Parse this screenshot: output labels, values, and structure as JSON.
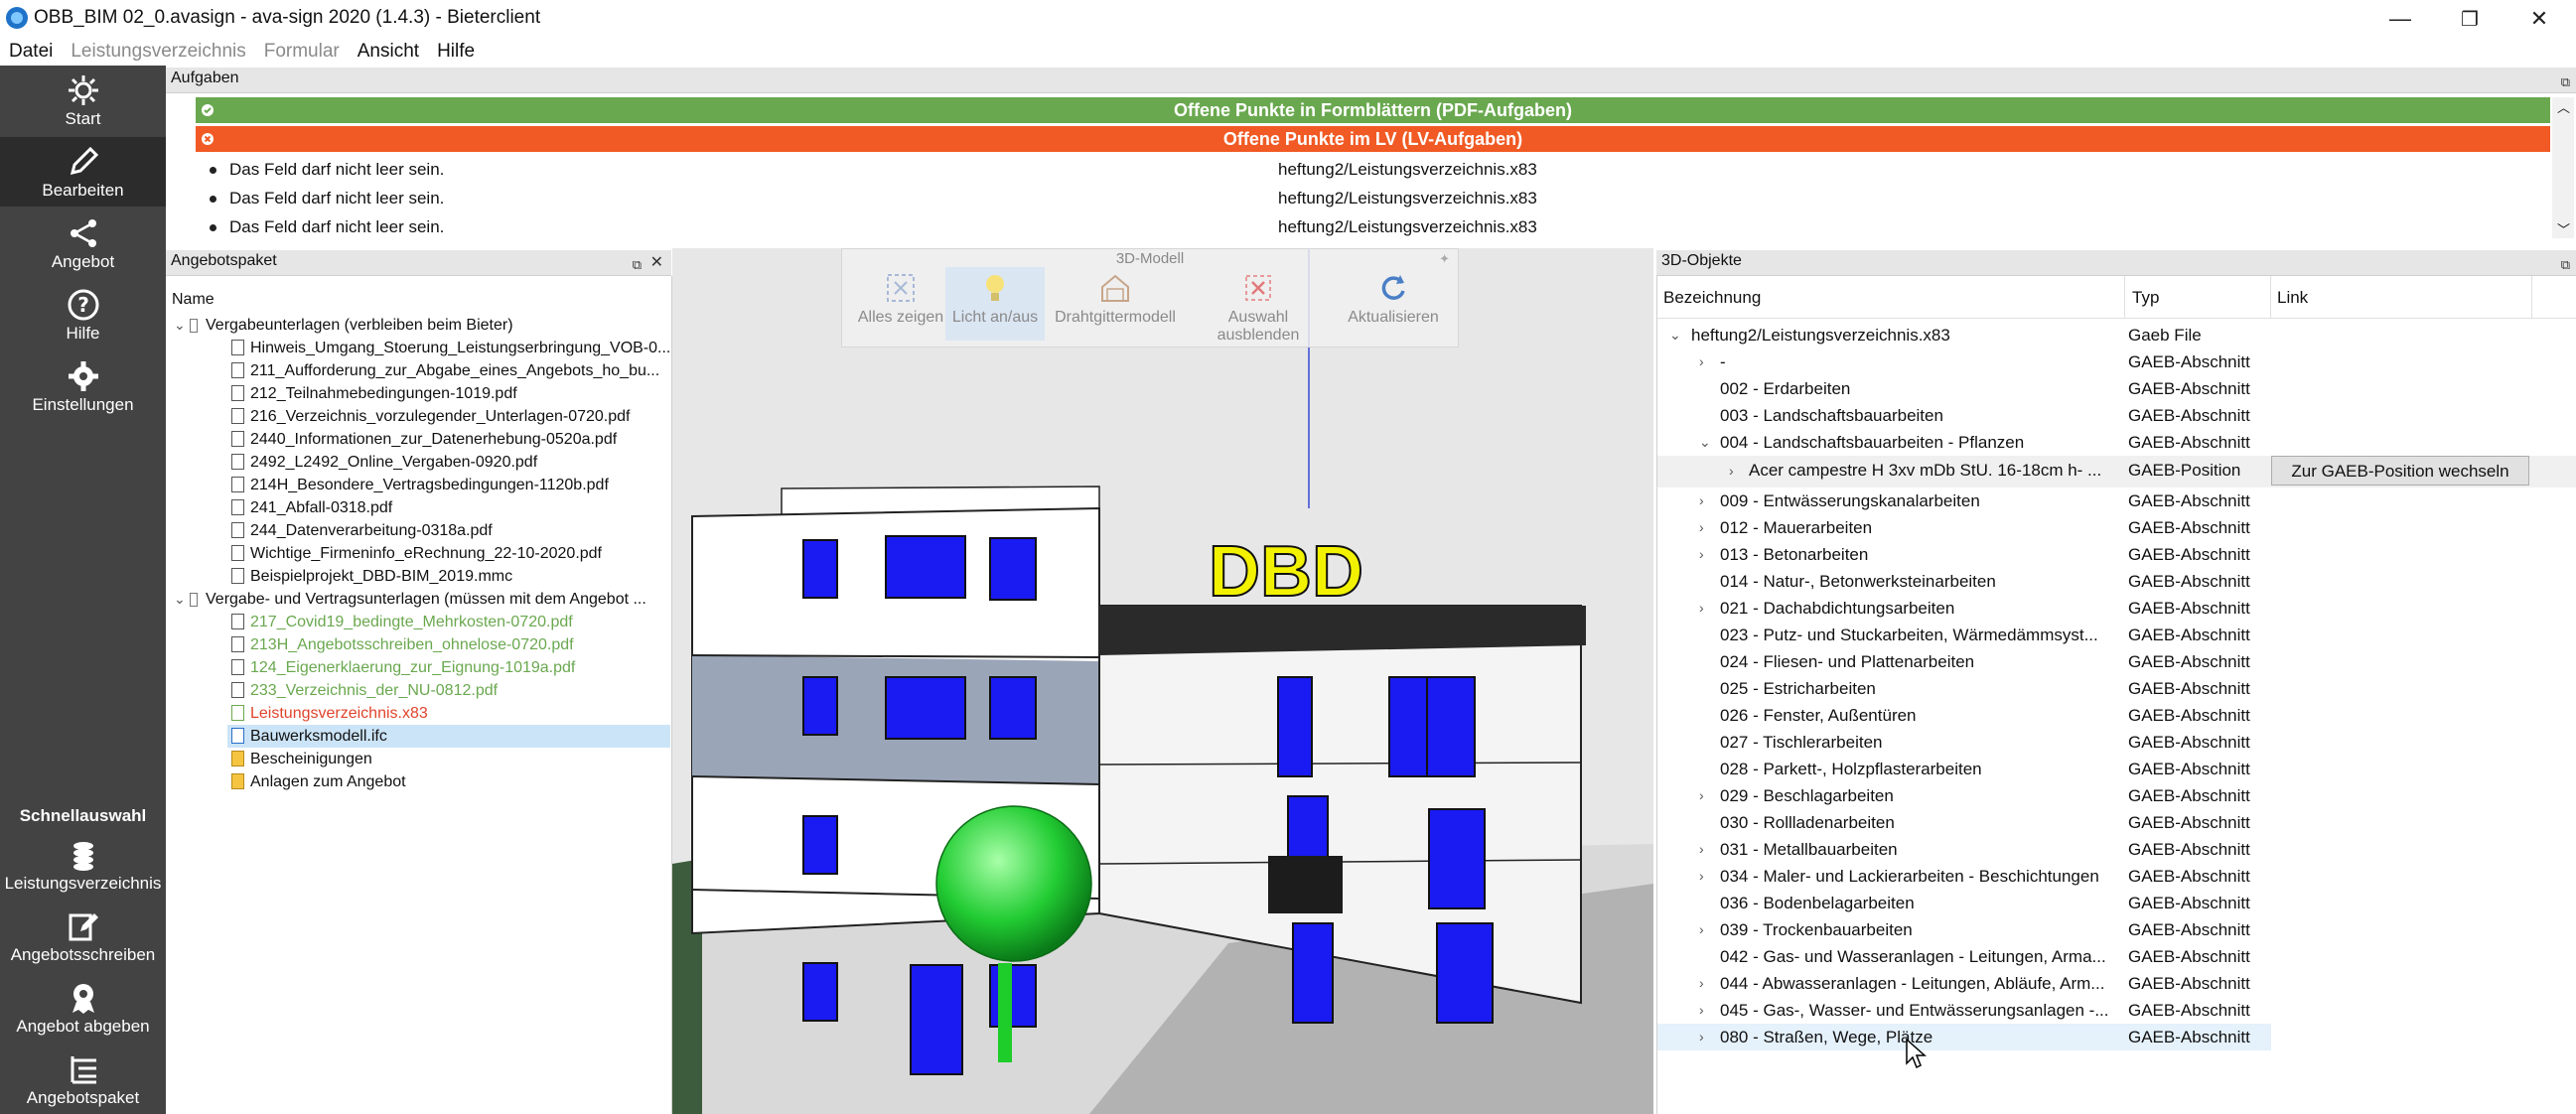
{
  "window": {
    "title": "OBB_BIM 02_0.avasign - ava-sign 2020 (1.4.3) - Bieterclient",
    "controls": [
      "—",
      "❐",
      "✕"
    ]
  },
  "menu": [
    "Datei",
    "Leistungsverzeichnis",
    "Formular",
    "Ansicht",
    "Hilfe"
  ],
  "sidebar": {
    "top_items": [
      {
        "label": "Start",
        "icon": "gear-sun-icon"
      },
      {
        "label": "Bearbeiten",
        "icon": "pencil-icon"
      },
      {
        "label": "Angebot",
        "icon": "share-icon"
      },
      {
        "label": "Hilfe",
        "icon": "help-icon"
      },
      {
        "label": "Einstellungen",
        "icon": "settings-icon"
      }
    ],
    "quick_title": "Schnellauswahl",
    "quick_items": [
      {
        "label": "Leistungsverzeichnis",
        "icon": "coins-icon"
      },
      {
        "label": "Angebotsschreiben",
        "icon": "edit-document-icon"
      },
      {
        "label": "Angebot abgeben",
        "icon": "medal-icon"
      },
      {
        "label": "Angebotspaket",
        "icon": "list-tree-icon"
      }
    ]
  },
  "tasks": {
    "title": "Aufgaben",
    "green_bar": "Offene Punkte in Formblättern (PDF-Aufgaben)",
    "red_bar": "Offene Punkte im LV (LV-Aufgaben)",
    "rows": [
      {
        "msg": "Das Feld darf nicht leer sein.",
        "file": "heftung2/Leistungsverzeichnis.x83"
      },
      {
        "msg": "Das Feld darf nicht leer sein.",
        "file": "heftung2/Leistungsverzeichnis.x83"
      },
      {
        "msg": "Das Feld darf nicht leer sein.",
        "file": "heftung2/Leistungsverzeichnis.x83"
      }
    ]
  },
  "package": {
    "title": "Angebotspaket",
    "column": "Name",
    "group1": "Vergabeunterlagen (verbleiben beim Bieter)",
    "group1_items": [
      "Hinweis_Umgang_Stoerung_Leistungserbringung_VOB-0...",
      "211_Aufforderung_zur_Abgabe_eines_Angebots_ho_bu...",
      "212_Teilnahmebedingungen-1019.pdf",
      "216_Verzeichnis_vorzulegender_Unterlagen-0720.pdf",
      "2440_Informationen_zur_Datenerhebung-0520a.pdf",
      "2492_L2492_Online_Vergaben-0920.pdf",
      "214H_Besondere_Vertragsbedingungen-1120b.pdf",
      "241_Abfall-0318.pdf",
      "244_Datenverarbeitung-0318a.pdf",
      "Wichtige_Firmeninfo_eRechnung_22-10-2020.pdf",
      "Beispielprojekt_DBD-BIM_2019.mmc"
    ],
    "group2": "Vergabe- und Vertragsunterlagen (müssen mit dem Angebot ...",
    "group2_items": [
      {
        "label": "217_Covid19_bedingte_Mehrkosten-0720.pdf",
        "color": "green"
      },
      {
        "label": "213H_Angebotsschreiben_ohnelose-0720.pdf",
        "color": "green"
      },
      {
        "label": "124_Eigenerklaerung_zur_Eignung-1019a.pdf",
        "color": "green"
      },
      {
        "label": "233_Verzeichnis_der_NU-0812.pdf",
        "color": "green"
      },
      {
        "label": "Leistungsverzeichnis.x83",
        "color": "red"
      },
      {
        "label": "Bauwerksmodell.ifc",
        "color": "normal"
      },
      {
        "label": "Bescheinigungen",
        "color": "normal"
      },
      {
        "label": "Anlagen zum Angebot",
        "color": "normal"
      }
    ]
  },
  "model3d": {
    "title": "3D-Modell",
    "buttons": [
      "Alles zeigen",
      "Licht an/aus",
      "Drahtgittermodell",
      "Auswahl ausblenden",
      "Aktualisieren"
    ],
    "sign_text": "DBD"
  },
  "objects": {
    "title": "3D-Objekte",
    "columns": [
      "Bezeichnung",
      "Typ",
      "Link"
    ],
    "root": {
      "label": "heftung2/Leistungsverzeichnis.x83",
      "type": "Gaeb File"
    },
    "rows": [
      {
        "label": "-",
        "type": "GAEB-Abschnitt",
        "chev": "›"
      },
      {
        "label": "002 - Erdarbeiten",
        "type": "GAEB-Abschnitt",
        "chev": ""
      },
      {
        "label": "003 - Landschaftsbauarbeiten",
        "type": "GAEB-Abschnitt",
        "chev": ""
      },
      {
        "label": "004 - Landschaftsbauarbeiten - Pflanzen",
        "type": "GAEB-Abschnitt",
        "chev": "⌄"
      },
      {
        "label": "009 - Entwässerungskanalarbeiten",
        "type": "GAEB-Abschnitt",
        "chev": "›"
      },
      {
        "label": "012 - Mauerarbeiten",
        "type": "GAEB-Abschnitt",
        "chev": "›"
      },
      {
        "label": "013 - Betonarbeiten",
        "type": "GAEB-Abschnitt",
        "chev": "›"
      },
      {
        "label": "014 - Natur-, Betonwerksteinarbeiten",
        "type": "GAEB-Abschnitt",
        "chev": ""
      },
      {
        "label": "021 - Dachabdichtungsarbeiten",
        "type": "GAEB-Abschnitt",
        "chev": "›"
      },
      {
        "label": "023 - Putz- und Stuckarbeiten, Wärmedämmsyst...",
        "type": "GAEB-Abschnitt",
        "chev": ""
      },
      {
        "label": "024 - Fliesen- und Plattenarbeiten",
        "type": "GAEB-Abschnitt",
        "chev": ""
      },
      {
        "label": "025 - Estricharbeiten",
        "type": "GAEB-Abschnitt",
        "chev": ""
      },
      {
        "label": "026 - Fenster, Außentüren",
        "type": "GAEB-Abschnitt",
        "chev": ""
      },
      {
        "label": "027 - Tischlerarbeiten",
        "type": "GAEB-Abschnitt",
        "chev": ""
      },
      {
        "label": "028 - Parkett-, Holzpflasterarbeiten",
        "type": "GAEB-Abschnitt",
        "chev": ""
      },
      {
        "label": "029 - Beschlagarbeiten",
        "type": "GAEB-Abschnitt",
        "chev": "›"
      },
      {
        "label": "030 - Rollladenarbeiten",
        "type": "GAEB-Abschnitt",
        "chev": ""
      },
      {
        "label": "031 - Metallbauarbeiten",
        "type": "GAEB-Abschnitt",
        "chev": "›"
      },
      {
        "label": "034 - Maler- und Lackierarbeiten - Beschichtungen",
        "type": "GAEB-Abschnitt",
        "chev": "›"
      },
      {
        "label": "036 - Bodenbelagarbeiten",
        "type": "GAEB-Abschnitt",
        "chev": ""
      },
      {
        "label": "039 - Trockenbauarbeiten",
        "type": "GAEB-Abschnitt",
        "chev": "›"
      },
      {
        "label": "042 - Gas- und Wasseranlagen - Leitungen, Arma...",
        "type": "GAEB-Abschnitt",
        "chev": ""
      },
      {
        "label": "044 - Abwasseranlagen - Leitungen, Abläufe, Arm...",
        "type": "GAEB-Abschnitt",
        "chev": "›"
      },
      {
        "label": "045 - Gas-, Wasser- und Entwässerungsanlagen -...",
        "type": "GAEB-Abschnitt",
        "chev": "›"
      },
      {
        "label": "080 - Straßen, Wege, Plätze",
        "type": "GAEB-Abschnitt",
        "chev": "›"
      }
    ],
    "position_row": {
      "label": "Acer campestre H 3xv mDb StU. 16-18cm h- ...",
      "type": "GAEB-Position",
      "link_button": "Zur GAEB-Position wechseln"
    }
  }
}
